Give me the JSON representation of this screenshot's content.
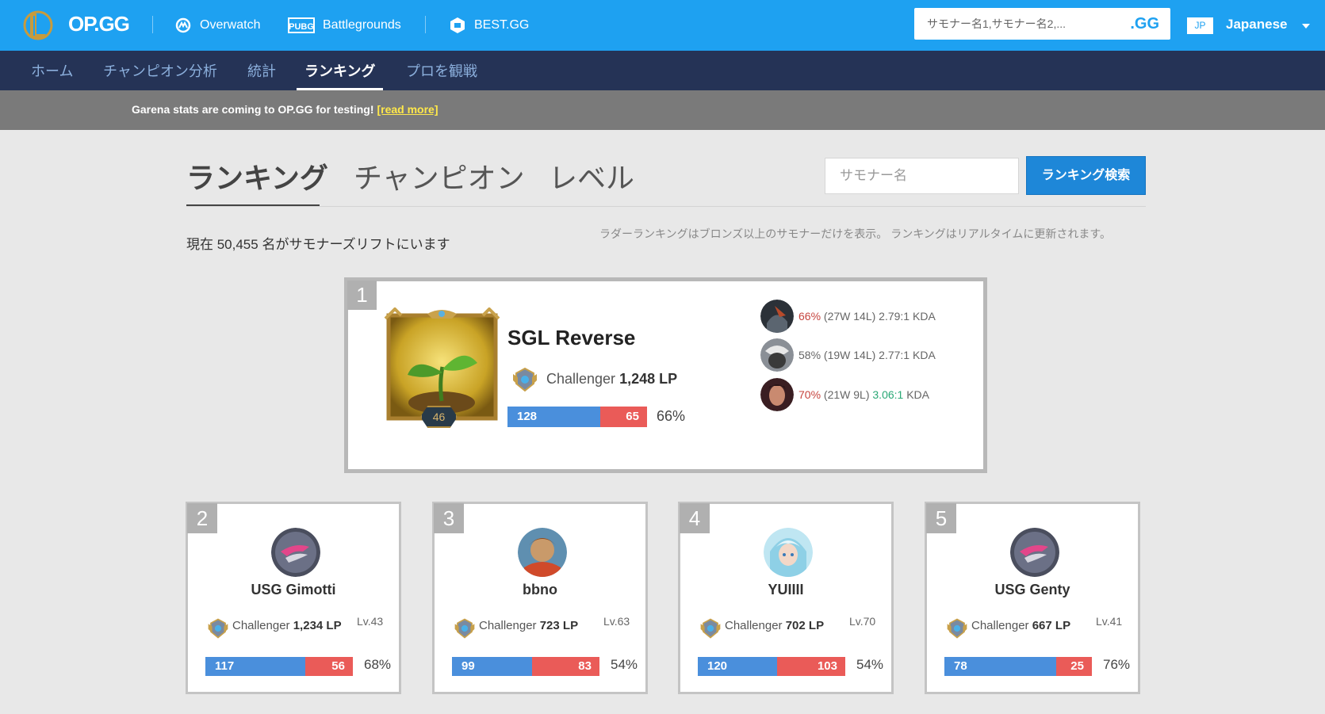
{
  "header": {
    "logo_text": "OP.GG",
    "links": [
      {
        "label": "Overwatch",
        "icon": "overwatch-icon"
      },
      {
        "label": "Battlegrounds",
        "icon": "pubg-icon"
      },
      {
        "label": "BEST.GG",
        "icon": "bestgg-icon"
      }
    ],
    "search_placeholder": "サモナー名1,サモナー名2,...",
    "search_button": ".GG",
    "lang_code": "JP",
    "lang_label": "Japanese"
  },
  "nav": {
    "items": [
      "ホーム",
      "チャンピオン分析",
      "統計",
      "ランキング",
      "プロを観戦"
    ],
    "active": "ランキング"
  },
  "banner": {
    "text": "Garena stats are coming to OP.GG for testing!",
    "link": "[read more]"
  },
  "ranking_tabs": [
    "ランキング",
    "チャンピオン",
    "レベル"
  ],
  "search": {
    "placeholder": "サモナー名",
    "button": "ランキング検索"
  },
  "count_text": "現在 50,455 名がサモナーズリフトにいます",
  "note_text": "ラダーランキングはブロンズ以上のサモナーだけを表示。 ランキングはリアルタイムに更新されます。",
  "top_player": {
    "rank": "1",
    "name": "SGL Reverse",
    "level": "46",
    "tier": "Challenger",
    "lp": "1,248 LP",
    "wins": 128,
    "losses": 65,
    "winrate": "66%",
    "champions": [
      {
        "winrate": "66%",
        "record": "(27W 14L)",
        "kda": "2.79:1",
        "kda_suffix": "KDA",
        "winrate_color": "#c6443e",
        "kda_color": "#666666"
      },
      {
        "winrate": "58%",
        "record": "(19W 14L)",
        "kda": "2.77:1",
        "kda_suffix": "KDA",
        "winrate_color": "#666666",
        "kda_color": "#666666"
      },
      {
        "winrate": "70%",
        "record": "(21W 9L)",
        "kda": "3.06:1",
        "kda_suffix": "KDA",
        "winrate_color": "#c6443e",
        "kda_color": "#2aa876"
      }
    ]
  },
  "players": [
    {
      "rank": "2",
      "name": "USG Gimotti",
      "tier": "Challenger",
      "lp": "1,234 LP",
      "level": "Lv.43",
      "wins": 117,
      "losses": 56,
      "winrate": "68%"
    },
    {
      "rank": "3",
      "name": "bbno",
      "tier": "Challenger",
      "lp": "723 LP",
      "level": "Lv.63",
      "wins": 99,
      "losses": 83,
      "winrate": "54%"
    },
    {
      "rank": "4",
      "name": "YUIIII",
      "tier": "Challenger",
      "lp": "702 LP",
      "level": "Lv.70",
      "wins": 120,
      "losses": 103,
      "winrate": "54%"
    },
    {
      "rank": "5",
      "name": "USG Genty",
      "tier": "Challenger",
      "lp": "667 LP",
      "level": "Lv.41",
      "wins": 78,
      "losses": 25,
      "winrate": "76%"
    }
  ],
  "colors": {
    "header_bg": "#1ea1f1",
    "nav_bg": "#253356",
    "win_bar": "#4a8fdc",
    "loss_bar": "#ea5b58",
    "accent_button": "#1e87d8"
  }
}
